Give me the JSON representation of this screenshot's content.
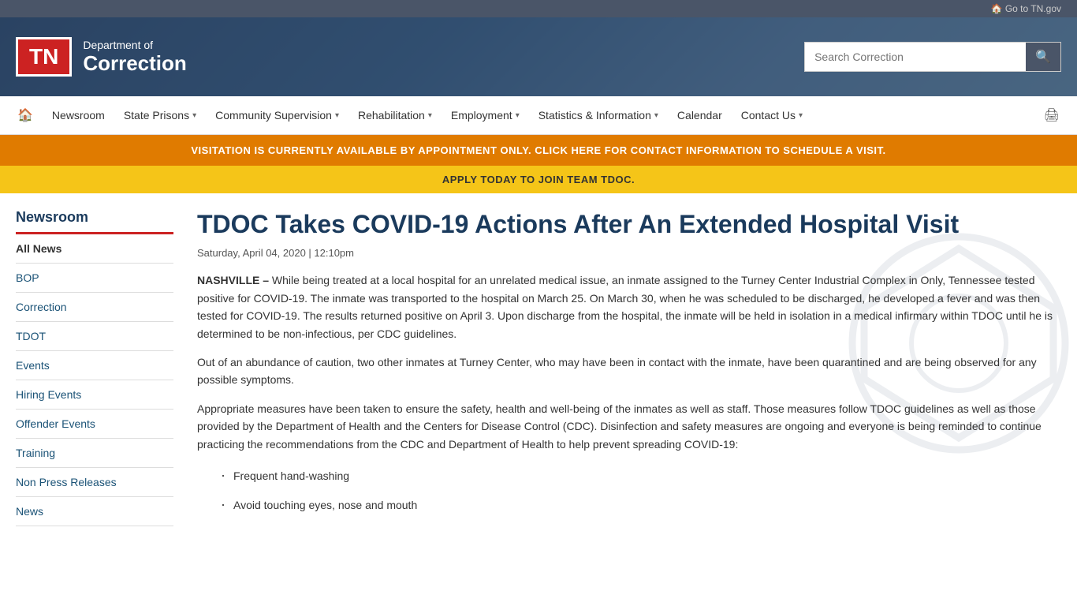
{
  "header": {
    "goto_label": "Go to TN.gov",
    "logo_tn": "TN",
    "logo_dept": "Department of",
    "logo_name": "Correction",
    "search_placeholder": "Search Correction"
  },
  "nav": {
    "home_icon": "🏠",
    "print_icon": "🖨",
    "items": [
      {
        "label": "Newsroom",
        "has_dropdown": false
      },
      {
        "label": "State Prisons",
        "has_dropdown": true
      },
      {
        "label": "Community Supervision",
        "has_dropdown": true
      },
      {
        "label": "Rehabilitation",
        "has_dropdown": true
      },
      {
        "label": "Employment",
        "has_dropdown": true
      },
      {
        "label": "Statistics & Information",
        "has_dropdown": true
      },
      {
        "label": "Calendar",
        "has_dropdown": false
      },
      {
        "label": "Contact Us",
        "has_dropdown": true
      }
    ]
  },
  "banners": {
    "orange": "VISITATION IS CURRENTLY AVAILABLE BY APPOINTMENT ONLY. CLICK HERE FOR CONTACT INFORMATION TO SCHEDULE A VISIT.",
    "yellow": "APPLY TODAY TO JOIN TEAM TDOC."
  },
  "sidebar": {
    "title": "Newsroom",
    "menu_items": [
      {
        "label": "All News",
        "active": true
      },
      {
        "label": "BOP",
        "active": false
      },
      {
        "label": "Correction",
        "active": false
      },
      {
        "label": "TDOT",
        "active": false
      },
      {
        "label": "Events",
        "active": false
      },
      {
        "label": "Hiring Events",
        "active": false
      },
      {
        "label": "Offender Events",
        "active": false
      },
      {
        "label": "Training",
        "active": false
      },
      {
        "label": "Non Press Releases",
        "active": false
      },
      {
        "label": "News",
        "active": false
      }
    ]
  },
  "article": {
    "title": "TDOC Takes COVID-19 Actions After An Extended Hospital Visit",
    "date": "Saturday, April 04, 2020 | 12:10pm",
    "paragraphs": [
      {
        "bold_prefix": "NASHVILLE –",
        "text": " While being treated at a local hospital for an unrelated medical issue, an inmate assigned to the Turney Center Industrial Complex in Only, Tennessee tested positive for COVID-19. The inmate was transported to the hospital on March 25.  On March 30, when he was scheduled to be discharged, he developed a fever and was then tested for COVID-19.  The results returned positive on April 3. Upon discharge from the hospital, the inmate will be held in isolation in a medical infirmary within TDOC until he is determined to be non-infectious, per CDC guidelines."
      },
      {
        "bold_prefix": "",
        "text": "Out of an abundance of caution, two other inmates at Turney Center, who may have been in contact with the inmate, have been quarantined and are being observed for any possible symptoms."
      },
      {
        "bold_prefix": "",
        "text": "Appropriate measures have been taken to ensure the safety, health and well-being of the inmates as well as staff.  Those measures follow TDOC guidelines as well as those provided by the Department of Health and the Centers for Disease Control (CDC). Disinfection and safety measures are ongoing and everyone is being reminded to continue practicing the recommendations from the CDC and Department of Health to help prevent spreading COVID-19:"
      }
    ],
    "bullets": [
      "Frequent hand-washing",
      "Avoid touching eyes, nose and mouth"
    ]
  }
}
